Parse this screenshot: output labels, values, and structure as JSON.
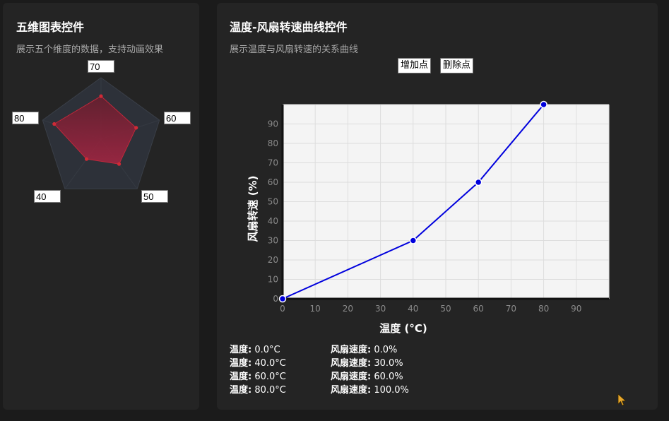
{
  "radar_panel": {
    "title": "五维图表控件",
    "subtitle": "展示五个维度的数据，支持动画效果",
    "values": [
      "70",
      "60",
      "50",
      "40",
      "80"
    ]
  },
  "curve_panel": {
    "title": "温度-风扇转速曲线控件",
    "subtitle": "展示温度与风扇转速的关系曲线",
    "add_button": "增加点",
    "delete_button": "删除点",
    "readouts": [
      {
        "temp_label": "温度:",
        "temp_value": "0.0°C",
        "fan_label": "风扇速度:",
        "fan_value": "0.0%"
      },
      {
        "temp_label": "温度:",
        "temp_value": "40.0°C",
        "fan_label": "风扇速度:",
        "fan_value": "30.0%"
      },
      {
        "temp_label": "温度:",
        "temp_value": "60.0°C",
        "fan_label": "风扇速度:",
        "fan_value": "60.0%"
      },
      {
        "temp_label": "温度:",
        "temp_value": "80.0°C",
        "fan_label": "风扇速度:",
        "fan_value": "100.0%"
      }
    ]
  },
  "chart_data": [
    {
      "type": "radar",
      "values": [
        70,
        60,
        50,
        40,
        80
      ],
      "max": 100,
      "colors": {
        "fill": "#8e2439",
        "stroke": "#c0283a",
        "grid": "#353a42"
      }
    },
    {
      "type": "line",
      "x": [
        0,
        40,
        60,
        80
      ],
      "y": [
        0,
        30,
        60,
        100
      ],
      "xlabel": "温度 (°C)",
      "ylabel": "风扇转速 (%)",
      "xlim": [
        0,
        100
      ],
      "ylim": [
        0,
        100
      ],
      "xticks": [
        "0",
        "10",
        "20",
        "30",
        "40",
        "50",
        "60",
        "70",
        "80",
        "90"
      ],
      "yticks": [
        "0",
        "10",
        "20",
        "30",
        "40",
        "50",
        "60",
        "70",
        "80",
        "90"
      ],
      "grid": true,
      "colors": {
        "line": "#0000dd",
        "plot_bg": "#f4f4f4",
        "grid": "#dddddd"
      }
    }
  ]
}
